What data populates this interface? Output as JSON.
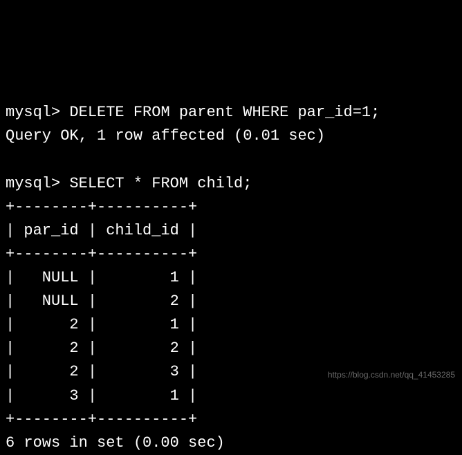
{
  "terminal": {
    "prompt1": "mysql> ",
    "command1": "DELETE FROM parent WHERE par_id=1;",
    "result1": "Query OK, 1 row affected (0.01 sec)",
    "blank": "",
    "prompt2": "mysql> ",
    "command2": "SELECT * FROM child;",
    "sep": "+--------+----------+",
    "header": "| par_id | child_id |",
    "rows": [
      "|   NULL |        1 |",
      "|   NULL |        2 |",
      "|      2 |        1 |",
      "|      2 |        2 |",
      "|      2 |        3 |",
      "|      3 |        1 |"
    ],
    "footer": "6 rows in set (0.00 sec)"
  },
  "watermark": "https://blog.csdn.net/qq_41453285"
}
